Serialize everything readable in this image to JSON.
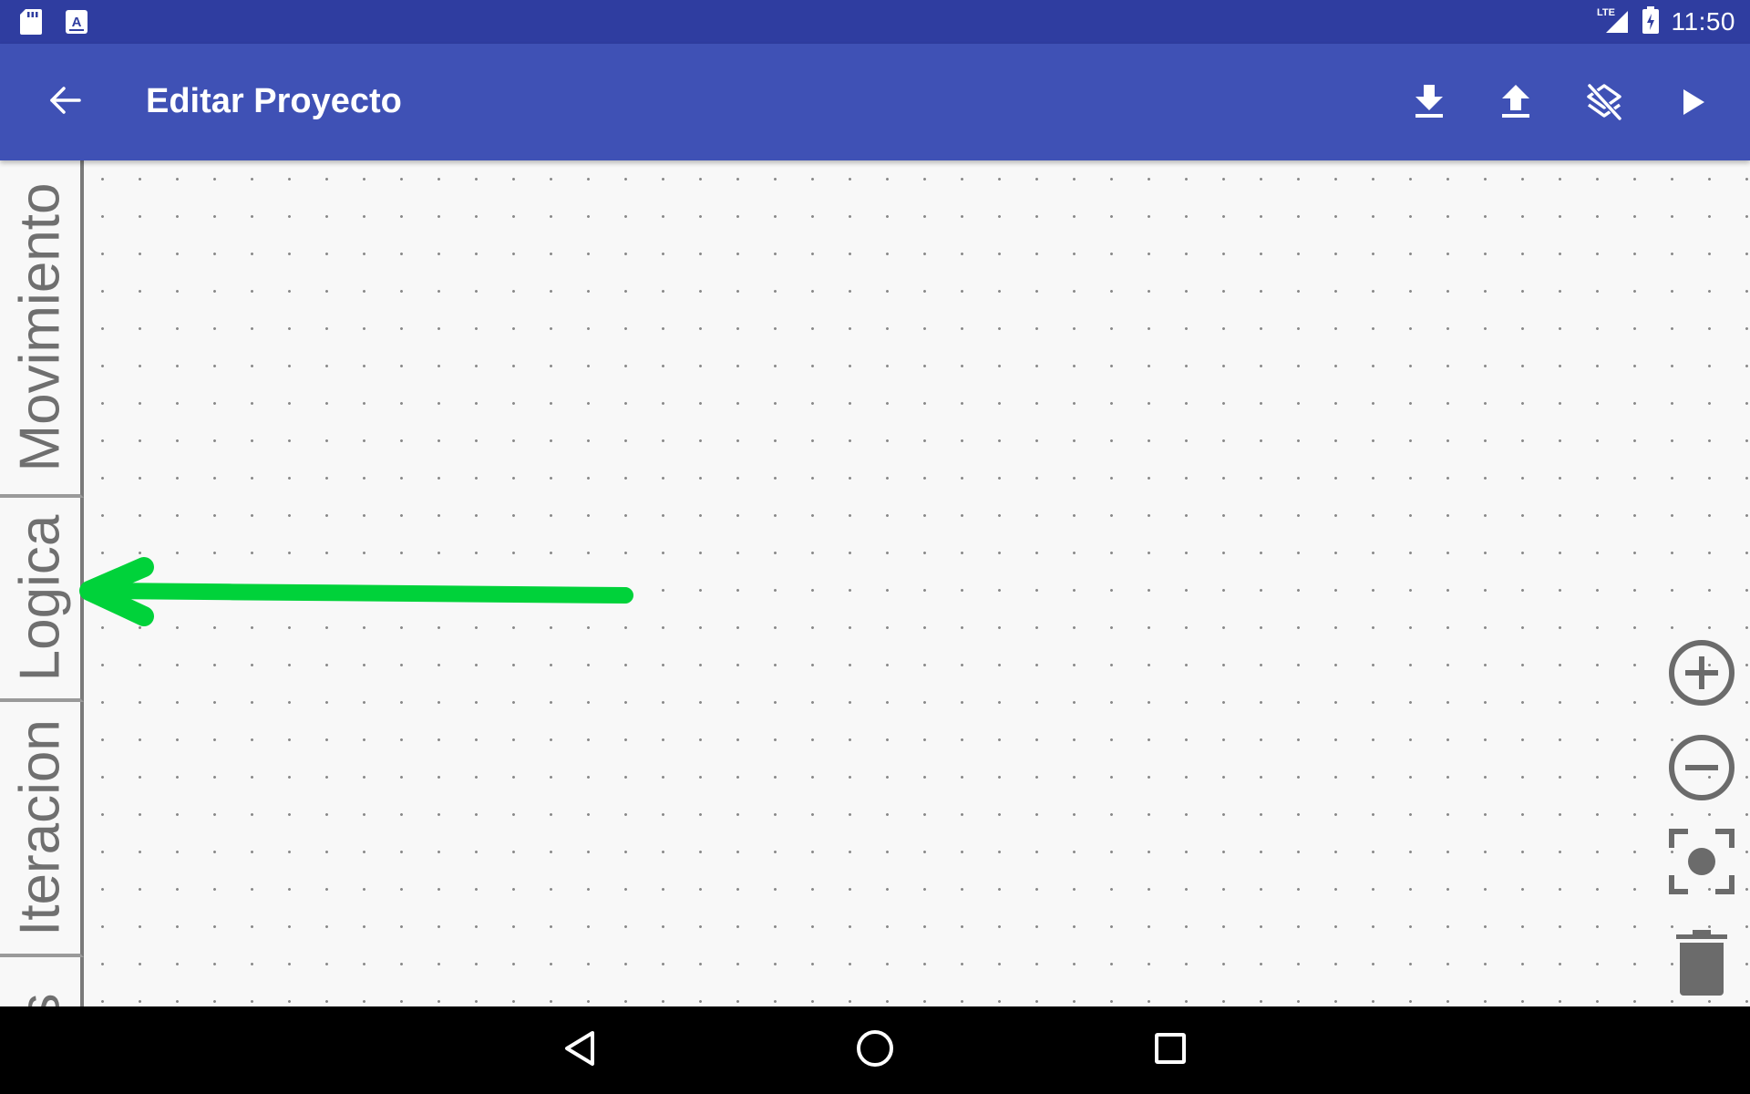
{
  "status_bar": {
    "time": "11:50",
    "network": "LTE",
    "icons": [
      "sd-card-icon",
      "app-notification-icon",
      "signal-icon",
      "battery-charging-icon"
    ]
  },
  "app_bar": {
    "title": "Editar Proyecto",
    "actions": [
      "download-icon",
      "upload-icon",
      "clear-layers-icon",
      "play-icon"
    ]
  },
  "side_tabs": {
    "items": [
      {
        "label": "Movimiento"
      },
      {
        "label": "Logica"
      },
      {
        "label": "Iteracion"
      },
      {
        "label": "s"
      }
    ]
  },
  "annotation": {
    "color": "#00d23a",
    "points_to": "Logica"
  },
  "tools": [
    "zoom-in-icon",
    "zoom-out-icon",
    "center-focus-icon",
    "trash-icon"
  ],
  "nav_bar": [
    "back-nav-icon",
    "home-nav-icon",
    "recents-nav-icon"
  ],
  "colors": {
    "status_bar": "#2f3da0",
    "app_bar": "#3f51b5",
    "canvas": "#f8f8f8",
    "tab_text": "#6f6f6f",
    "tool_gray": "#6b6b6b"
  }
}
